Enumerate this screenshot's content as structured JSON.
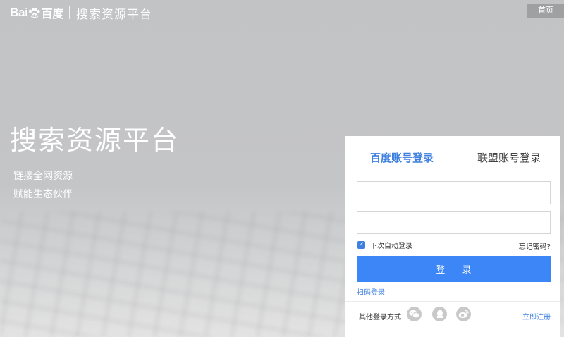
{
  "header": {
    "logo_text": "Bai百度",
    "platform_title": "搜索资源平台",
    "home_button": "首页"
  },
  "hero": {
    "title": "搜索资源平台",
    "line1": "链接全网资源",
    "line2": "赋能生态伙伴"
  },
  "login_panel": {
    "tabs": [
      {
        "label": "百度账号登录",
        "active": true
      },
      {
        "label": "联盟账号登录",
        "active": false
      }
    ],
    "username_value": "",
    "password_value": "",
    "remember_label": "下次自动登录",
    "remember_checked": true,
    "forgot_link": "忘记密码?",
    "login_button": "登 录",
    "qr_login_link": "扫码登录",
    "other_methods_label": "其他登录方式",
    "social_icons": [
      "wechat-icon",
      "qq-icon",
      "weibo-icon"
    ],
    "register_link": "立即注册"
  },
  "colors": {
    "accent": "#3f7fe0",
    "button": "#3c86f7"
  }
}
